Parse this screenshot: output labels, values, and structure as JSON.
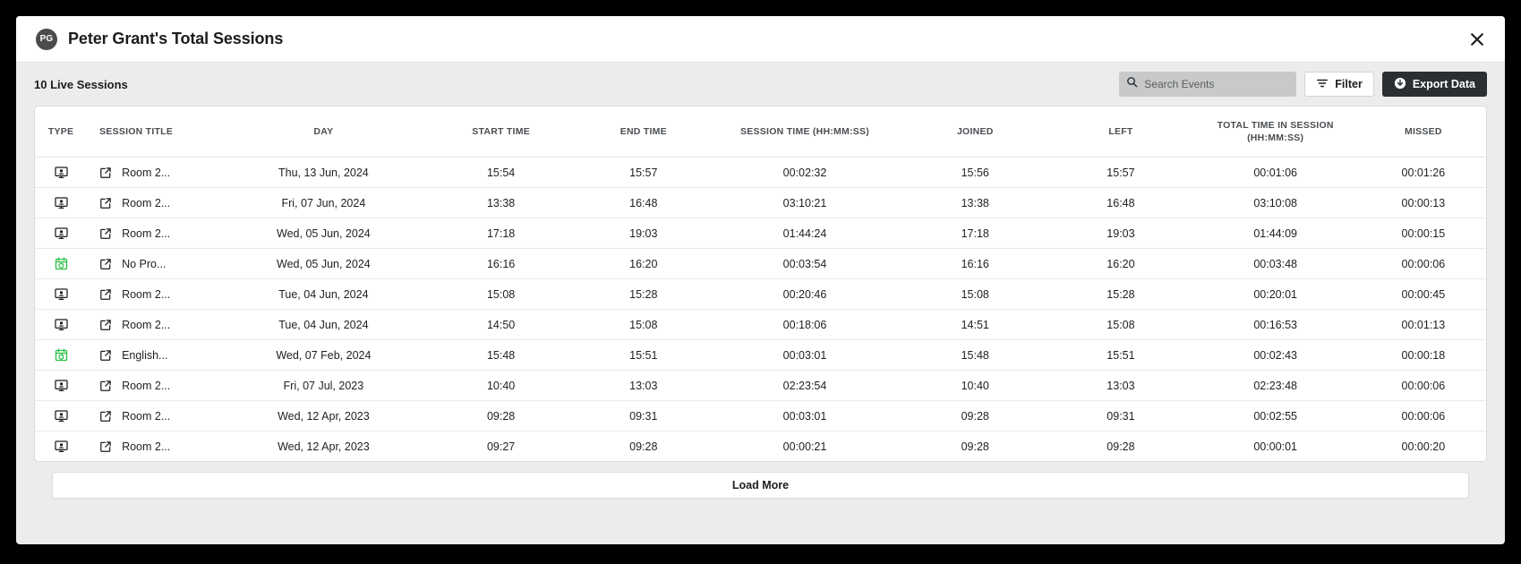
{
  "header": {
    "avatar_initials": "PG",
    "title": "Peter Grant's Total Sessions",
    "close_icon": "close-icon"
  },
  "toolbar": {
    "sessions_count_label": "10 Live Sessions",
    "search_placeholder": "Search Events",
    "search_value": "",
    "search_icon": "search-icon",
    "filter_label": "Filter",
    "filter_icon": "filter-icon",
    "export_label": "Export Data",
    "export_icon": "download-circle-icon",
    "export_bg_color": "#2b2f33"
  },
  "table": {
    "columns": [
      {
        "key": "type",
        "label": "TYPE"
      },
      {
        "key": "title",
        "label": "SESSION TITLE"
      },
      {
        "key": "day",
        "label": "DAY"
      },
      {
        "key": "start",
        "label": "START TIME"
      },
      {
        "key": "end",
        "label": "END TIME"
      },
      {
        "key": "session",
        "label": "SESSION TIME (HH:MM:SS)"
      },
      {
        "key": "joined",
        "label": "JOINED"
      },
      {
        "key": "left",
        "label": "LEFT"
      },
      {
        "key": "total",
        "label": "TOTAL TIME IN SESSION (HH:MM:SS)"
      },
      {
        "key": "missed",
        "label": "MISSED"
      }
    ],
    "type_icon_colors": {
      "webinar": "#1c1c1c",
      "recurring": "#2cc14a"
    },
    "link_icon": "external-link-icon",
    "rows": [
      {
        "type_icon": "webinar-screen-icon",
        "type_kind": "webinar",
        "title": "Room 2...",
        "day": "Thu, 13 Jun, 2024",
        "start": "15:54",
        "end": "15:57",
        "session": "00:02:32",
        "joined": "15:56",
        "left": "15:57",
        "total": "00:01:06",
        "missed": "00:01:26"
      },
      {
        "type_icon": "webinar-screen-icon",
        "type_kind": "webinar",
        "title": "Room 2...",
        "day": "Fri, 07 Jun, 2024",
        "start": "13:38",
        "end": "16:48",
        "session": "03:10:21",
        "joined": "13:38",
        "left": "16:48",
        "total": "03:10:08",
        "missed": "00:00:13"
      },
      {
        "type_icon": "webinar-screen-icon",
        "type_kind": "webinar",
        "title": "Room 2...",
        "day": "Wed, 05 Jun, 2024",
        "start": "17:18",
        "end": "19:03",
        "session": "01:44:24",
        "joined": "17:18",
        "left": "19:03",
        "total": "01:44:09",
        "missed": "00:00:15"
      },
      {
        "type_icon": "recurring-calendar-icon",
        "type_kind": "recurring",
        "title": "No Pro...",
        "day": "Wed, 05 Jun, 2024",
        "start": "16:16",
        "end": "16:20",
        "session": "00:03:54",
        "joined": "16:16",
        "left": "16:20",
        "total": "00:03:48",
        "missed": "00:00:06"
      },
      {
        "type_icon": "webinar-screen-icon",
        "type_kind": "webinar",
        "title": "Room 2...",
        "day": "Tue, 04 Jun, 2024",
        "start": "15:08",
        "end": "15:28",
        "session": "00:20:46",
        "joined": "15:08",
        "left": "15:28",
        "total": "00:20:01",
        "missed": "00:00:45"
      },
      {
        "type_icon": "webinar-screen-icon",
        "type_kind": "webinar",
        "title": "Room 2...",
        "day": "Tue, 04 Jun, 2024",
        "start": "14:50",
        "end": "15:08",
        "session": "00:18:06",
        "joined": "14:51",
        "left": "15:08",
        "total": "00:16:53",
        "missed": "00:01:13"
      },
      {
        "type_icon": "recurring-calendar-icon",
        "type_kind": "recurring",
        "title": "English...",
        "day": "Wed, 07 Feb, 2024",
        "start": "15:48",
        "end": "15:51",
        "session": "00:03:01",
        "joined": "15:48",
        "left": "15:51",
        "total": "00:02:43",
        "missed": "00:00:18"
      },
      {
        "type_icon": "webinar-screen-icon",
        "type_kind": "webinar",
        "title": "Room 2...",
        "day": "Fri, 07 Jul, 2023",
        "start": "10:40",
        "end": "13:03",
        "session": "02:23:54",
        "joined": "10:40",
        "left": "13:03",
        "total": "02:23:48",
        "missed": "00:00:06"
      },
      {
        "type_icon": "webinar-screen-icon",
        "type_kind": "webinar",
        "title": "Room 2...",
        "day": "Wed, 12 Apr, 2023",
        "start": "09:28",
        "end": "09:31",
        "session": "00:03:01",
        "joined": "09:28",
        "left": "09:31",
        "total": "00:02:55",
        "missed": "00:00:06"
      },
      {
        "type_icon": "webinar-screen-icon",
        "type_kind": "webinar",
        "title": "Room 2...",
        "day": "Wed, 12 Apr, 2023",
        "start": "09:27",
        "end": "09:28",
        "session": "00:00:21",
        "joined": "09:28",
        "left": "09:28",
        "total": "00:00:01",
        "missed": "00:00:20"
      }
    ]
  },
  "footer": {
    "load_more_label": "Load More"
  }
}
